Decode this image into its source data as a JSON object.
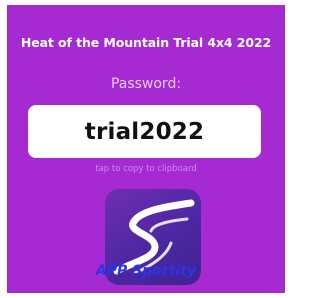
{
  "screen": {
    "title": "Heat of the Mountain Trial 4x4 2022",
    "password_label": "Password:",
    "password_value": "trial2022",
    "copy_hint": "tap to copy to clipboard",
    "app_name": "APP Sportity"
  },
  "colors": {
    "background": "#a52ad2",
    "password_box": "#ffffff",
    "app_name": "#2b35e8"
  },
  "icons": {
    "app_logo": "sportity-logo-icon"
  }
}
